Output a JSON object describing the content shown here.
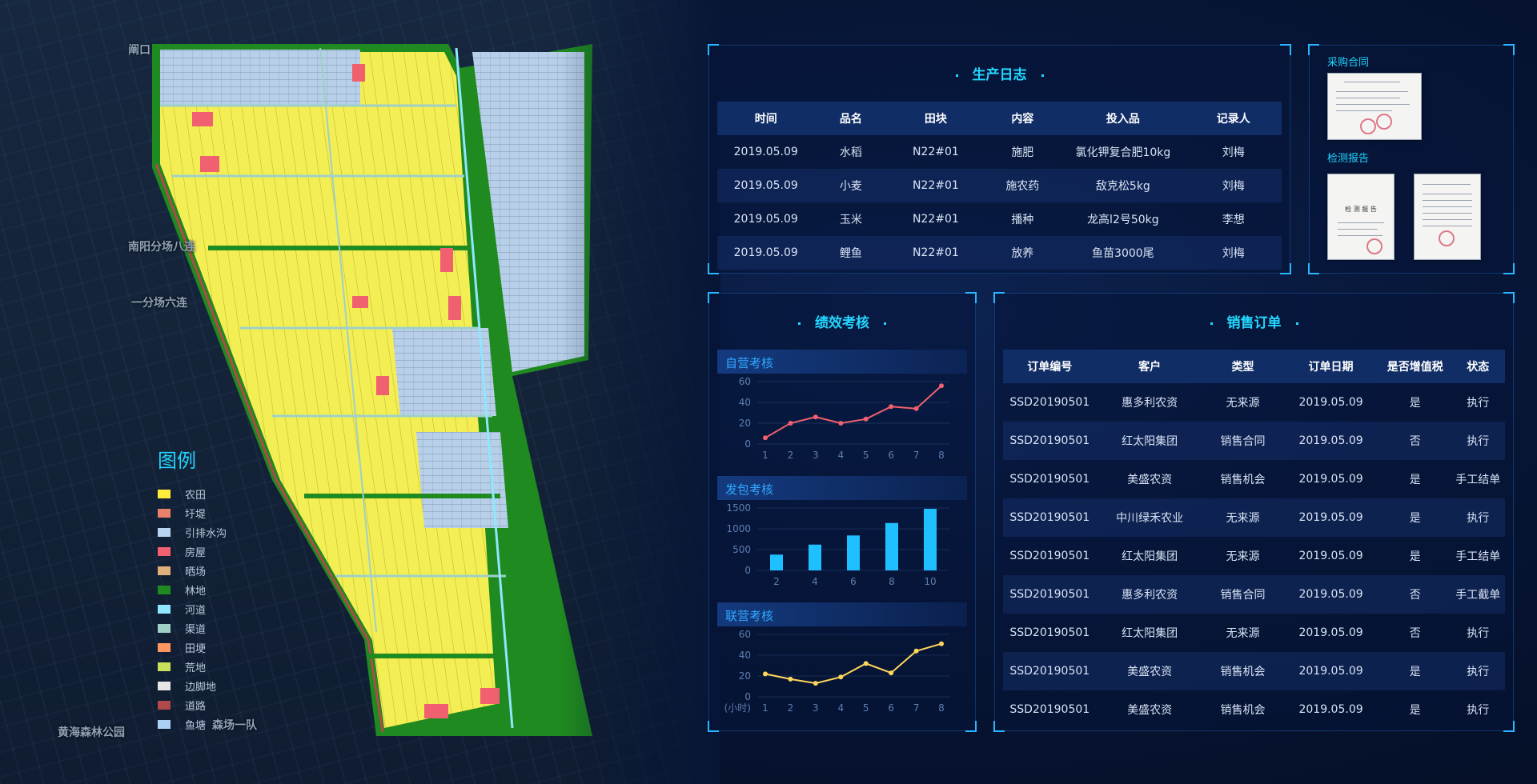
{
  "map": {
    "place_labels": [
      "阐口",
      "南阳分场八连",
      "一分场六连",
      "黄海森林公园",
      "森场一队"
    ],
    "legend": {
      "title": "图例",
      "items": [
        {
          "label": "农田",
          "color": "#ffeb3b"
        },
        {
          "label": "圩堤",
          "color": "#e8806a"
        },
        {
          "label": "引排水沟",
          "color": "#b7d4f0"
        },
        {
          "label": "房屋",
          "color": "#f0606e"
        },
        {
          "label": "晒场",
          "color": "#e0b07a"
        },
        {
          "label": "林地",
          "color": "#1f8a1f"
        },
        {
          "label": "河道",
          "color": "#8fe6ff"
        },
        {
          "label": "渠道",
          "color": "#9ed0c8"
        },
        {
          "label": "田埂",
          "color": "#ff9660"
        },
        {
          "label": "荒地",
          "color": "#c8e05a"
        },
        {
          "label": "边脚地",
          "color": "#e6e6e6"
        },
        {
          "label": "道路",
          "color": "#b04a4a"
        },
        {
          "label": "鱼塘",
          "color": "#aad0f5"
        }
      ]
    }
  },
  "production_log": {
    "title": "生产日志",
    "headers": [
      "时间",
      "品名",
      "田块",
      "内容",
      "投入品",
      "记录人"
    ],
    "rows": [
      [
        "2019.05.09",
        "水稻",
        "N22#01",
        "施肥",
        "氯化钾复合肥10kg",
        "刘梅"
      ],
      [
        "2019.05.09",
        "小麦",
        "N22#01",
        "施农药",
        "敌克松5kg",
        "刘梅"
      ],
      [
        "2019.05.09",
        "玉米",
        "N22#01",
        "播种",
        "龙高l2号50kg",
        "李想"
      ],
      [
        "2019.05.09",
        "鲤鱼",
        "N22#01",
        "放养",
        "鱼苗3000尾",
        "刘梅"
      ]
    ]
  },
  "documents": {
    "purchase_contract_label": "采购合同",
    "inspection_report_label": "检测报告",
    "report_thumb_text": "检 测 报 告"
  },
  "performance": {
    "title": "绩效考核",
    "charts": [
      {
        "title": "自营考核"
      },
      {
        "title": "发包考核"
      },
      {
        "title": "联营考核"
      }
    ]
  },
  "chart_data": [
    {
      "type": "line",
      "title": "自营考核",
      "x": [
        1,
        2,
        3,
        4,
        5,
        6,
        7,
        8
      ],
      "series": [
        {
          "values": [
            6,
            20,
            26,
            20,
            24,
            36,
            34,
            56
          ]
        }
      ],
      "ylim": [
        0,
        60
      ],
      "yticks": [
        0,
        20,
        40,
        60
      ],
      "color": "#f0606e"
    },
    {
      "type": "bar",
      "title": "发包考核",
      "x": [
        2,
        4,
        6,
        8,
        10
      ],
      "series": [
        {
          "values": [
            380,
            620,
            840,
            1140,
            1480
          ]
        }
      ],
      "ylim": [
        0,
        1500
      ],
      "yticks": [
        0,
        500,
        1000,
        1500
      ],
      "color": "#1ec0ff"
    },
    {
      "type": "line",
      "title": "联营考核",
      "x": [
        1,
        2,
        3,
        4,
        5,
        6,
        7,
        8
      ],
      "series": [
        {
          "values": [
            22,
            17,
            13,
            19,
            32,
            23,
            44,
            51
          ]
        }
      ],
      "ylim": [
        0,
        60
      ],
      "yticks": [
        0,
        20,
        40,
        60
      ],
      "unit_label": "(小时)",
      "color": "#ffd75a"
    }
  ],
  "sales_orders": {
    "title": "销售订单",
    "headers": [
      "订单编号",
      "客户",
      "类型",
      "订单日期",
      "是否增值税",
      "状态"
    ],
    "rows": [
      [
        "SSD20190501",
        "惠多利农资",
        "无来源",
        "2019.05.09",
        "是",
        "执行"
      ],
      [
        "SSD20190501",
        "红太阳集团",
        "销售合同",
        "2019.05.09",
        "否",
        "执行"
      ],
      [
        "SSD20190501",
        "美盛农资",
        "销售机会",
        "2019.05.09",
        "是",
        "手工结单"
      ],
      [
        "SSD20190501",
        "中川绿禾农业",
        "无来源",
        "2019.05.09",
        "是",
        "执行"
      ],
      [
        "SSD20190501",
        "红太阳集团",
        "无来源",
        "2019.05.09",
        "是",
        "手工结单"
      ],
      [
        "SSD20190501",
        "惠多利农资",
        "销售合同",
        "2019.05.09",
        "否",
        "手工截单"
      ],
      [
        "SSD20190501",
        "红太阳集团",
        "无来源",
        "2019.05.09",
        "否",
        "执行"
      ],
      [
        "SSD20190501",
        "美盛农资",
        "销售机会",
        "2019.05.09",
        "是",
        "执行"
      ],
      [
        "SSD20190501",
        "美盛农资",
        "销售机会",
        "2019.05.09",
        "是",
        "执行"
      ]
    ]
  }
}
